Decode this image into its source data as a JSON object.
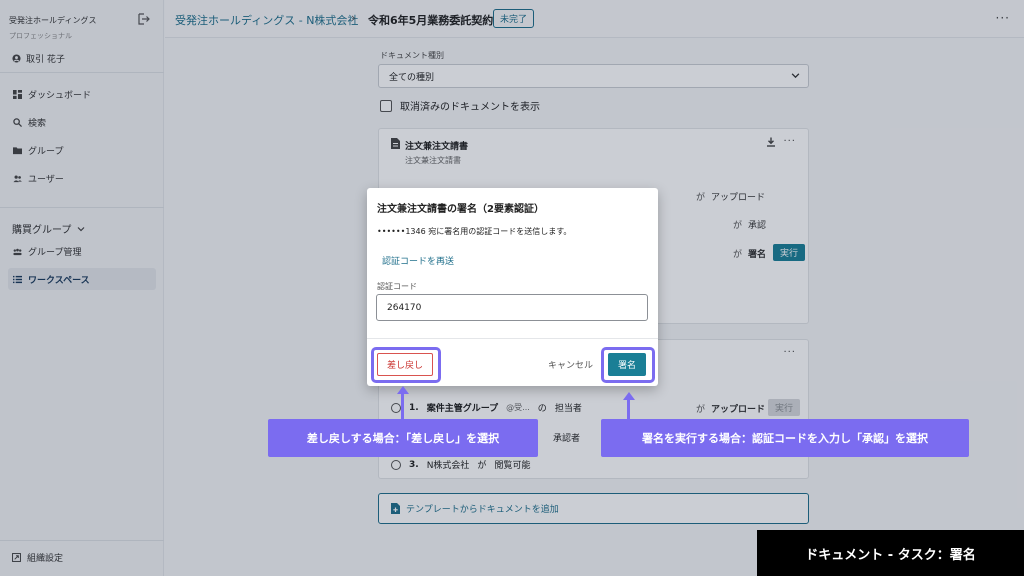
{
  "sidebar": {
    "org_name": "受発注ホールディングス",
    "plan": "プロフェッショナル",
    "user_name": "取引 花子",
    "nav": [
      {
        "label": "ダッシュボード",
        "icon": "dashboard-icon"
      },
      {
        "label": "検索",
        "icon": "search-icon"
      },
      {
        "label": "グループ",
        "icon": "folder-icon"
      },
      {
        "label": "ユーザー",
        "icon": "users-icon"
      }
    ],
    "section_label": "購買グループ",
    "group_nav": [
      {
        "label": "グループ管理",
        "icon": "group-icon"
      },
      {
        "label": "ワークスペース",
        "icon": "list-icon"
      }
    ],
    "settings_label": "組織設定"
  },
  "header": {
    "breadcrumb_link": "受発注ホールディングス - N株式会社",
    "separator": "›",
    "current": "令和6年5月業務委託契約",
    "status": "未完了",
    "more": "···"
  },
  "main": {
    "doctype_label": "ドキュメント種別",
    "doctype_value": "全ての種別",
    "show_cancelled": "取消済みのドキュメントを表示",
    "card1": {
      "title": "注文兼注文請書",
      "subtitle": "注文兼注文請書",
      "steps": [
        {
          "ga": "が",
          "action": "アップロード"
        },
        {
          "ga": "が",
          "action": "承認"
        },
        {
          "ga": "が",
          "action": "署名",
          "button": "実行"
        }
      ]
    },
    "card2": {
      "steps": [
        {
          "num": "1.",
          "text": "案件主管グループ",
          "mention": "@受...",
          "no": "の",
          "role": "担当者",
          "ga": "が",
          "action": "アップロード",
          "button": "実行"
        },
        {
          "role": "承認者"
        },
        {
          "num": "3.",
          "text": "N株式会社",
          "ga": "が",
          "action": "閲覧可能"
        }
      ]
    },
    "add_doc": "テンプレートからドキュメントを追加"
  },
  "modal": {
    "title": "注文兼注文請書の署名（2要素認証）",
    "description": "••••••1346 宛に署名用の認証コードを送信します。",
    "resend": "認証コードを再送",
    "code_label": "認証コード",
    "code_value": "264170",
    "return_button": "差し戻し",
    "cancel_button": "キャンセル",
    "sign_button": "署名"
  },
  "annotations": {
    "left": "差し戻しする場合：「差し戻し」を選択",
    "right": "署名を実行する場合：認証コードを入力し「承認」を選択",
    "color": "#7b6cf0"
  },
  "caption": "ドキュメント - タスク：署名"
}
